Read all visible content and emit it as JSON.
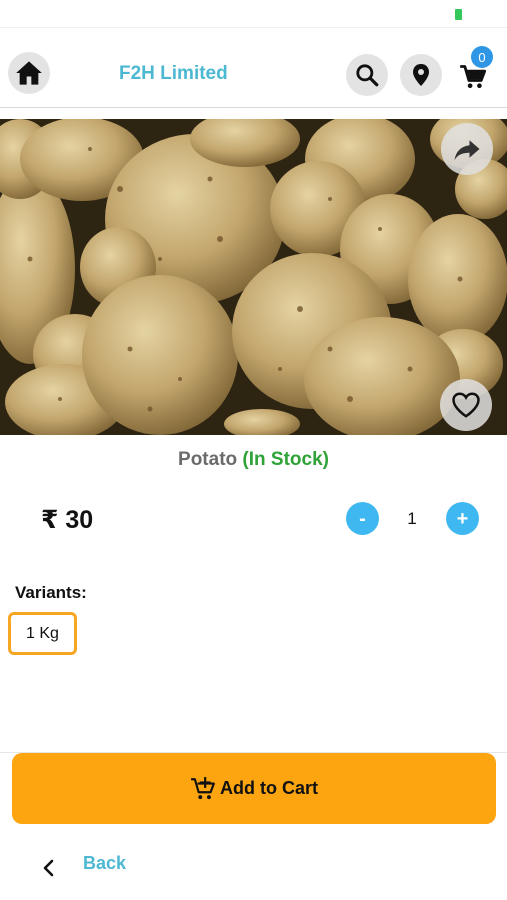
{
  "header": {
    "brand_title": "F2H Limited",
    "cart_count": "0",
    "icons": [
      "home-icon",
      "search-icon",
      "location-pin-icon",
      "cart-icon"
    ]
  },
  "product": {
    "name": "Potato",
    "stock_status": "(In Stock)",
    "price": "₹ 30",
    "quantity": "1",
    "image_icons": [
      "share-icon",
      "heart-icon"
    ],
    "carousel": {
      "current_slide": 1,
      "total_slides": 1
    }
  },
  "quantity_controls": {
    "minus": "-",
    "plus": "+"
  },
  "variants": {
    "label": "Variants:",
    "options": [
      "1 Kg"
    ],
    "selected": "1 Kg"
  },
  "actions": {
    "add_to_cart": "Add to Cart",
    "back": "Back"
  },
  "colors": {
    "brand": "#4db8d1",
    "in_stock": "#2fa338",
    "accent": "#fca510",
    "qty_button": "#3fb7f0",
    "badge": "#2f96e6"
  }
}
